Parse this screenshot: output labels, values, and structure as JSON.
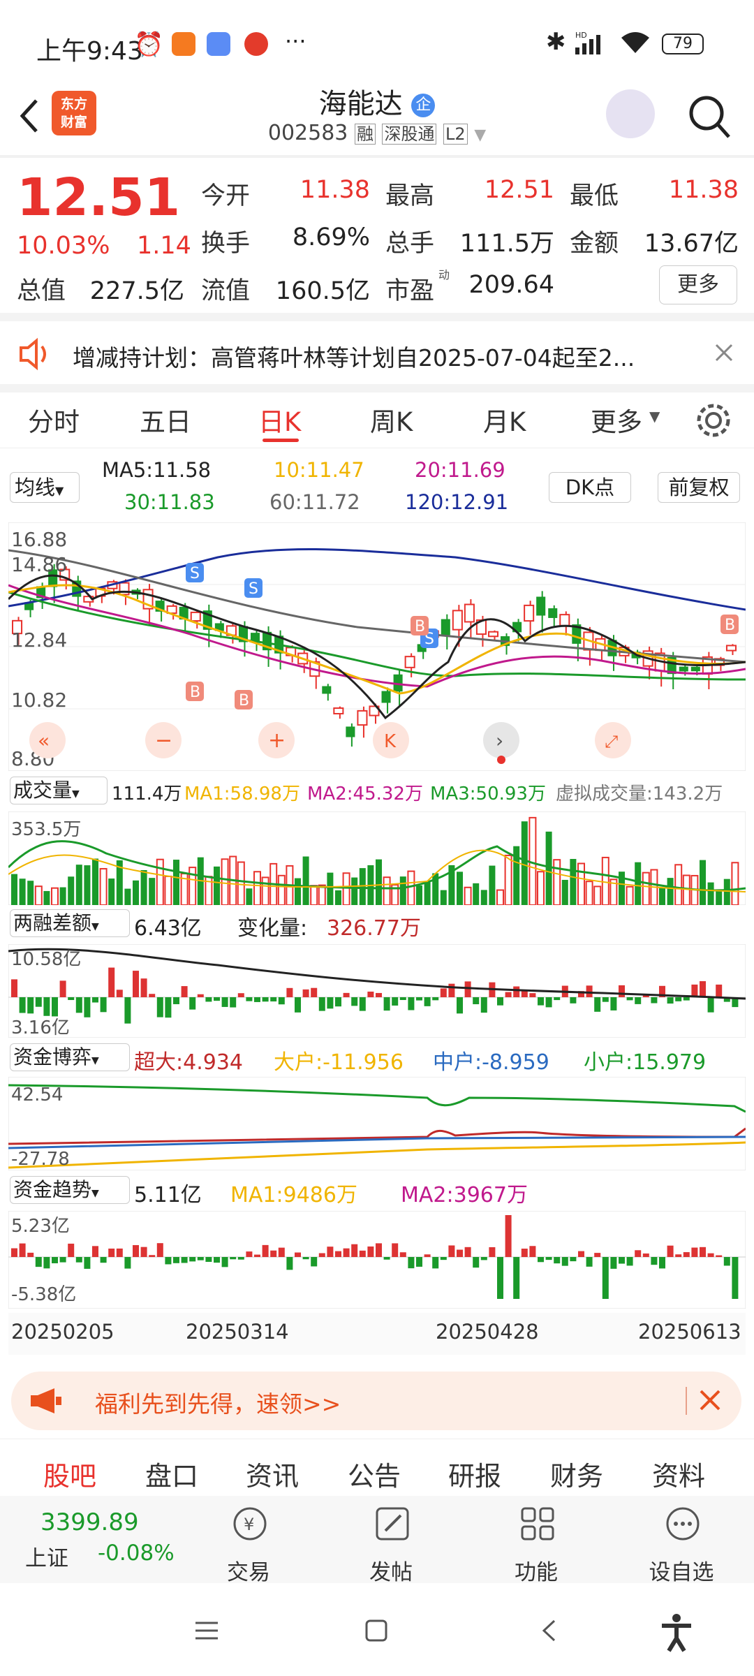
{
  "status": {
    "time": "上午9:43",
    "battery": "79",
    "more": "···"
  },
  "header": {
    "logo_line1": "东方",
    "logo_line2": "财富",
    "title": "海能达",
    "title_badge": "企",
    "code": "002583",
    "tags": [
      "融",
      "深股通",
      "L2"
    ]
  },
  "quote": {
    "price": "12.51",
    "change_pct": "10.03%",
    "change": "1.14",
    "open_label": "今开",
    "open": "11.38",
    "high_label": "最高",
    "high": "12.51",
    "low_label": "最低",
    "low": "11.38",
    "turnover_label": "换手",
    "turnover": "8.69%",
    "volume_label": "总手",
    "volume": "111.5万",
    "amount_label": "金额",
    "amount": "13.67亿",
    "mcap_label": "总值",
    "mcap": "227.5亿",
    "float_label": "流值",
    "float": "160.5亿",
    "pe_label": "市盈",
    "pe_sup": "动",
    "pe": "209.64",
    "more_label": "更多"
  },
  "notice": {
    "text": "增减持计划：高管蒋叶林等计划自2025-07-04起至2..."
  },
  "tabs": [
    "分时",
    "五日",
    "日K",
    "周K",
    "月K",
    "更多"
  ],
  "active_tab": 2,
  "ma_panel": {
    "selector": "均线",
    "ma5": "MA5:11.58",
    "ma10": "10:11.47",
    "ma20": "20:11.69",
    "ma30": "30:11.83",
    "ma60": "60:11.72",
    "ma120": "120:12.91",
    "dk_btn": "DK点",
    "adj_btn": "前复权"
  },
  "kline": {
    "y_labels": [
      "16.88",
      "14.86",
      "12.84",
      "10.82",
      "8.80"
    ],
    "markers": [
      "S",
      "S",
      "S",
      "B",
      "B",
      "B",
      "B"
    ]
  },
  "volume_panel": {
    "selector": "成交量",
    "value": "111.4万",
    "ma1": "MA1:58.98万",
    "ma2": "MA2:45.32万",
    "ma3": "MA3:50.93万",
    "virtual": "虚拟成交量:143.2万",
    "y_top": "353.5万"
  },
  "margin_panel": {
    "selector": "两融差额",
    "value": "6.43亿",
    "change_label": "变化量:",
    "change": "326.77万",
    "y_top": "10.58亿",
    "y_bottom": "3.16亿"
  },
  "fund_panel": {
    "selector": "资金博弈",
    "super": "超大:4.934",
    "large": "大户:-11.956",
    "mid": "中户:-8.959",
    "small": "小户:15.979",
    "y_top": "42.54",
    "y_bottom": "-27.78"
  },
  "trend_panel": {
    "selector": "资金趋势",
    "value": "5.11亿",
    "ma1": "MA1:9486万",
    "ma2": "MA2:3967万",
    "y_top": "5.23亿",
    "y_bottom": "-5.38亿"
  },
  "dates": [
    "20250205",
    "20250314",
    "20250428",
    "20250613"
  ],
  "promo": {
    "text": "福利先到先得，速领>>"
  },
  "bottom_tabs": [
    "股吧",
    "盘口",
    "资讯",
    "公告",
    "研报",
    "财务",
    "资料"
  ],
  "dock": {
    "index_value": "3399.89",
    "index_name": "上证",
    "index_change": "-0.08%",
    "items": [
      "交易",
      "发帖",
      "功能",
      "设自选"
    ]
  },
  "colors": {
    "up": "#e8322d",
    "down": "#1a9a2a",
    "brand": "#f0592b"
  }
}
